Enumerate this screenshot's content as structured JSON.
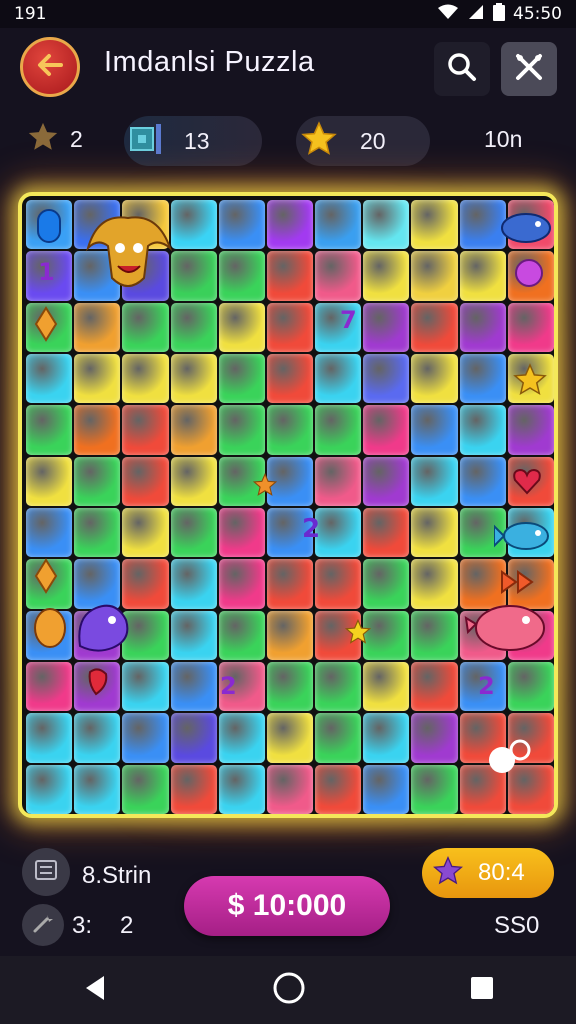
{
  "status_bar": {
    "left_text": "191",
    "time": "45:50"
  },
  "header": {
    "title": "Imdanlsi Puzzla"
  },
  "stats": {
    "stars": "2",
    "tools": "13",
    "coins": "20",
    "time_left": "10n"
  },
  "board": {
    "rows": [
      [
        "#3aa0f5",
        "#3a6ff0",
        "#f5c83a",
        "#3ad3f5",
        "#3a8ff5",
        "#a23af0",
        "#3a9ff0",
        "#64e6f0",
        "#f0e040",
        "#3a7ff0",
        "#f04a6a",
        "#f05a8a"
      ],
      [
        "#6a4af0",
        "#3a8ff5",
        "#5a4ae0",
        "#3ad05a",
        "#3ad35a",
        "#f04a3a",
        "#f05a8a",
        "#f0e040",
        "#f0d040",
        "#f0e040",
        "#f07020"
      ],
      [
        "#3ad35a",
        "#f0a030",
        "#3ad35a",
        "#3ad35a",
        "#f0e040",
        "#f04a3a",
        "#3ad3f0",
        "#a03ad0",
        "#f04a3a",
        "#a03ad0",
        "#f03a8a"
      ],
      [
        "#3ad3f0",
        "#f0e040",
        "#f0e040",
        "#f0e040",
        "#3ad35a",
        "#f04a3a",
        "#3ad3f0",
        "#5a6af0",
        "#f0e040",
        "#3a8ff5",
        "#f0e040"
      ],
      [
        "#3ad35a",
        "#f07020",
        "#f04a3a",
        "#f0a030",
        "#3ad35a",
        "#3ad35a",
        "#3ad35a",
        "#f03a8a",
        "#3a8ff5",
        "#3ad3f0",
        "#a03ad0"
      ],
      [
        "#f0e040",
        "#3ad35a",
        "#f04a3a",
        "#f0e040",
        "#3ad35a",
        "#3a8ff5",
        "#f05a8a",
        "#a03ad0",
        "#3ad3f0",
        "#3a8ff5",
        "#f04a3a"
      ],
      [
        "#3a8ff5",
        "#3ad35a",
        "#f0e040",
        "#3ad35a",
        "#f03a8a",
        "#3a8ff5",
        "#3ad3f0",
        "#f04a3a",
        "#f0e040",
        "#3ad35a",
        "#3ad3f0"
      ],
      [
        "#3ad35a",
        "#3a8ff5",
        "#f04a3a",
        "#3ad3f0",
        "#f03a8a",
        "#f04a3a",
        "#f04a3a",
        "#3ad35a",
        "#f0e040",
        "#f07020",
        "#f07020"
      ],
      [
        "#3a8ff5",
        "#a03ad0",
        "#3ad35a",
        "#3ad3f0",
        "#3ad35a",
        "#f0a030",
        "#f04a3a",
        "#3ad35a",
        "#3ad35a",
        "#f05a8a",
        "#f03a8a"
      ],
      [
        "#f03a8a",
        "#a03ad0",
        "#3ad3f0",
        "#3a8ff5",
        "#f05a8a",
        "#3ad35a",
        "#3ad35a",
        "#f0e040",
        "#f04a3a",
        "#3a8ff5",
        "#3ad35a"
      ],
      [
        "#3ad3f0",
        "#3ad3f0",
        "#3a8ff5",
        "#5a4ae0",
        "#3ad3f0",
        "#f0e040",
        "#3ad35a",
        "#3ad3f0",
        "#a03ad0",
        "#f04a3a",
        "#f04a3a"
      ],
      [
        "#3ad3f0",
        "#3ad3f0",
        "#3ad35a",
        "#f04a3a",
        "#3ad3f0",
        "#f05a8a",
        "#f04a3a",
        "#3a8ff5",
        "#3ad35a",
        "#f04a3a",
        "#f04a3a"
      ]
    ],
    "labels": {
      "two_a": "2",
      "two_b": "2",
      "two_c": "2",
      "seven": "7",
      "one": "1"
    }
  },
  "bottom": {
    "left_label": "8.Strin",
    "left_sub": "3:",
    "left_sub_value": "2",
    "money_button": "$ 10:000",
    "score": "80:4",
    "score_sub": "SS0"
  },
  "colors": {
    "accent": "#d63ab0",
    "gold": "#f8c01c",
    "board_border": "#f4e85a"
  }
}
